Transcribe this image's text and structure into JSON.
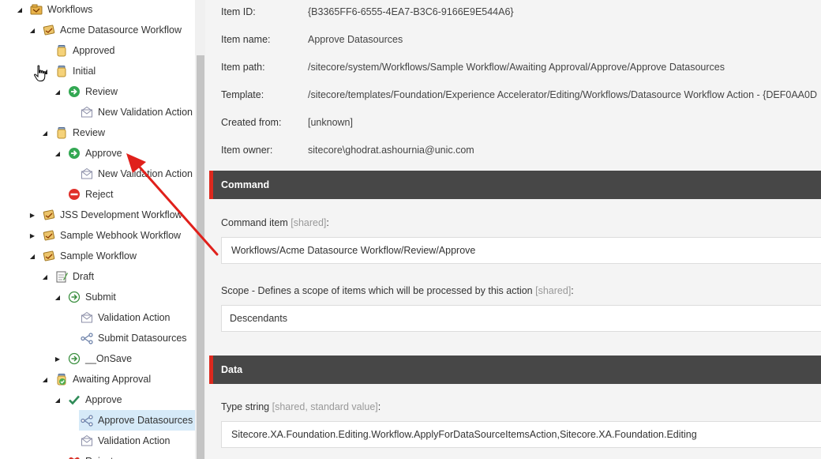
{
  "tree": {
    "items": [
      {
        "label": "Workflows",
        "icon": "workflow-folder-icon",
        "indent": 0,
        "toggle": "expanded"
      },
      {
        "label": "Acme Datasource Workflow",
        "icon": "workflow-icon",
        "indent": 1,
        "toggle": "expanded"
      },
      {
        "label": "Approved",
        "icon": "state-icon",
        "indent": 2,
        "toggle": "none"
      },
      {
        "label": "Initial",
        "icon": "state-icon",
        "indent": 2,
        "toggle": "expanded"
      },
      {
        "label": "Review",
        "icon": "command-green-icon",
        "indent": 3,
        "toggle": "expanded"
      },
      {
        "label": "New Validation Action",
        "icon": "action-envelope-icon",
        "indent": 4,
        "toggle": "none"
      },
      {
        "label": "Review",
        "icon": "state-icon",
        "indent": 2,
        "toggle": "expanded"
      },
      {
        "label": "Approve",
        "icon": "command-green-icon",
        "indent": 3,
        "toggle": "expanded"
      },
      {
        "label": "New Validation Action",
        "icon": "action-envelope-icon",
        "indent": 4,
        "toggle": "none"
      },
      {
        "label": "Reject",
        "icon": "reject-red-icon",
        "indent": 3,
        "toggle": "none"
      },
      {
        "label": "JSS Development Workflow",
        "icon": "workflow-icon",
        "indent": 1,
        "toggle": "collapsed"
      },
      {
        "label": "Sample Webhook Workflow",
        "icon": "workflow-icon",
        "indent": 1,
        "toggle": "collapsed"
      },
      {
        "label": "Sample Workflow",
        "icon": "workflow-icon",
        "indent": 1,
        "toggle": "expanded"
      },
      {
        "label": "Draft",
        "icon": "draft-state-icon",
        "indent": 2,
        "toggle": "expanded"
      },
      {
        "label": "Submit",
        "icon": "command-outline-icon",
        "indent": 3,
        "toggle": "expanded"
      },
      {
        "label": "Validation Action",
        "icon": "action-envelope-icon",
        "indent": 4,
        "toggle": "none"
      },
      {
        "label": "Submit Datasources",
        "icon": "action-share-icon",
        "indent": 4,
        "toggle": "none"
      },
      {
        "label": "__OnSave",
        "icon": "command-outline-icon",
        "indent": 3,
        "toggle": "collapsed"
      },
      {
        "label": "Awaiting Approval",
        "icon": "approval-state-icon",
        "indent": 2,
        "toggle": "expanded"
      },
      {
        "label": "Approve",
        "icon": "checkmark-icon",
        "indent": 3,
        "toggle": "expanded"
      },
      {
        "label": "Approve Datasources",
        "icon": "action-share-icon",
        "indent": 4,
        "toggle": "none",
        "selected": true
      },
      {
        "label": "Validation Action",
        "icon": "action-envelope-icon",
        "indent": 4,
        "toggle": "none"
      },
      {
        "label": "Reject",
        "icon": "reject-heart-icon",
        "indent": 3,
        "toggle": "none"
      }
    ]
  },
  "info": [
    {
      "label": "Item ID:",
      "value": "{B3365FF6-6555-4EA7-B3C6-9166E9E544A6}"
    },
    {
      "label": "Item name:",
      "value": "Approve Datasources"
    },
    {
      "label": "Item path:",
      "value": "/sitecore/system/Workflows/Sample Workflow/Awaiting Approval/Approve/Approve Datasources"
    },
    {
      "label": "Template:",
      "value": "/sitecore/templates/Foundation/Experience Accelerator/Editing/Workflows/Datasource Workflow Action - {DEF0AA0D"
    },
    {
      "label": "Created from:",
      "value": "[unknown]"
    },
    {
      "label": "Item owner:",
      "value": "sitecore\\ghodrat.ashournia@unic.com"
    }
  ],
  "sections": {
    "command": {
      "title": "Command",
      "command_item_label": "Command item",
      "command_item_shared": "[shared]",
      "command_item_colon": ":",
      "command_item_value": "Workflows/Acme Datasource Workflow/Review/Approve",
      "scope_label": "Scope - Defines a scope of items which will be processed by this action",
      "scope_shared": "[shared]",
      "scope_colon": ":",
      "scope_value": "Descendants"
    },
    "data": {
      "title": "Data",
      "type_label": "Type string",
      "type_shared": "[shared, standard value]",
      "type_colon": ":",
      "type_value": "Sitecore.XA.Foundation.Editing.Workflow.ApplyForDataSourceItemsAction,Sitecore.XA.Foundation.Editing"
    }
  },
  "colors": {
    "accent_red": "#dc291e",
    "section_header": "#474747",
    "selected_row": "#d6eaf8",
    "arrow": "#e0201b"
  }
}
